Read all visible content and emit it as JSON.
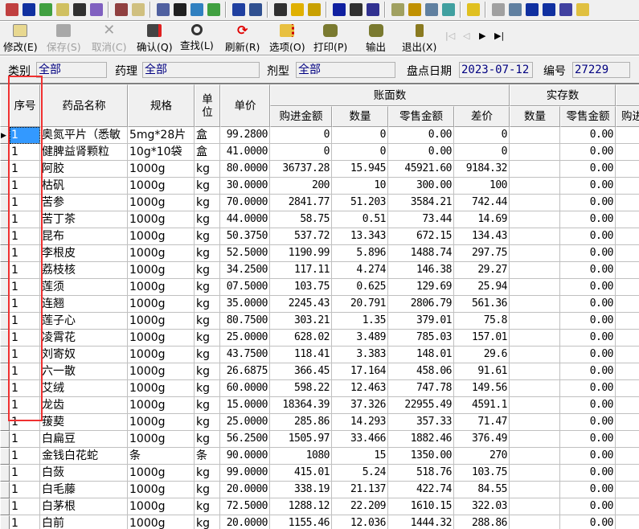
{
  "toolbar_icons": [
    "medical-kit",
    "bottle",
    "mail-check",
    "edit-doc",
    "binoculars",
    "chart-doc",
    "stamp",
    "card",
    "clipboard",
    "checkbox",
    "paste",
    "doc-check",
    "calendar-edit",
    "window-grid",
    "dots-grid",
    "bell",
    "pv-box",
    "bucket",
    "binoculars-2",
    "binoculars-3",
    "hand-folder",
    "key",
    "magnifier",
    "close-box",
    "folder-arrow",
    "disk-gray",
    "magnifier-2",
    "list",
    "windows",
    "doc-check-2",
    "clipboard-2"
  ],
  "toolbar": {
    "edit": "修改(E)",
    "save": "保存(S)",
    "cancel": "取消(C)",
    "confirm": "确认(Q)",
    "find": "查找(L)",
    "refresh": "刷新(R)",
    "options": "选项(O)",
    "print": "打印(P)",
    "export": "输出",
    "exit": "退出(X)"
  },
  "filters": {
    "category_label": "类别",
    "category_value": "全部",
    "pharm_label": "药理",
    "pharm_value": "全部",
    "form_label": "剂型",
    "form_value": "全部",
    "date_label": "盘点日期",
    "date_value": "2023-07-12",
    "no_label": "编号",
    "no_value": "27229"
  },
  "headers": {
    "seq": "序号",
    "name": "药品名称",
    "spec": "规格",
    "unit": "单位",
    "price": "单价",
    "book": "账面数",
    "actual": "实存数",
    "purchase": "购进金额",
    "qty": "数量",
    "retail": "零售金额",
    "diff": "差价",
    "a_qty": "数量",
    "a_retail": "零售金额",
    "a_purchase": "购进"
  },
  "rows": [
    [
      "1",
      "奥氮平片（悉敏",
      "5mg*28片",
      "盒",
      "99.2800",
      "0",
      "0",
      "0.00",
      "0",
      "",
      "0.00"
    ],
    [
      "1",
      "健脾益肾颗粒",
      "10g*10袋",
      "盒",
      "41.0000",
      "0",
      "0",
      "0.00",
      "0",
      "",
      "0.00"
    ],
    [
      "1",
      "阿胶",
      "1000g",
      "kg",
      "80.0000",
      "36737.28",
      "15.945",
      "45921.60",
      "9184.32",
      "",
      "0.00"
    ],
    [
      "1",
      "枯矾",
      "1000g",
      "kg",
      "30.0000",
      "200",
      "10",
      "300.00",
      "100",
      "",
      "0.00"
    ],
    [
      "1",
      "苦参",
      "1000g",
      "kg",
      "70.0000",
      "2841.77",
      "51.203",
      "3584.21",
      "742.44",
      "",
      "0.00"
    ],
    [
      "1",
      "苦丁茶",
      "1000g",
      "kg",
      "44.0000",
      "58.75",
      "0.51",
      "73.44",
      "14.69",
      "",
      "0.00"
    ],
    [
      "1",
      "昆布",
      "1000g",
      "kg",
      "50.3750",
      "537.72",
      "13.343",
      "672.15",
      "134.43",
      "",
      "0.00"
    ],
    [
      "1",
      "李根皮",
      "1000g",
      "kg",
      "52.5000",
      "1190.99",
      "5.896",
      "1488.74",
      "297.75",
      "",
      "0.00"
    ],
    [
      "1",
      "荔枝核",
      "1000g",
      "kg",
      "34.2500",
      "117.11",
      "4.274",
      "146.38",
      "29.27",
      "",
      "0.00"
    ],
    [
      "1",
      "莲须",
      "1000g",
      "kg",
      "07.5000",
      "103.75",
      "0.625",
      "129.69",
      "25.94",
      "",
      "0.00"
    ],
    [
      "1",
      "连翘",
      "1000g",
      "kg",
      "35.0000",
      "2245.43",
      "20.791",
      "2806.79",
      "561.36",
      "",
      "0.00"
    ],
    [
      "1",
      "莲子心",
      "1000g",
      "kg",
      "80.7500",
      "303.21",
      "1.35",
      "379.01",
      "75.8",
      "",
      "0.00"
    ],
    [
      "1",
      "凌霄花",
      "1000g",
      "kg",
      "25.0000",
      "628.02",
      "3.489",
      "785.03",
      "157.01",
      "",
      "0.00"
    ],
    [
      "1",
      "刘寄奴",
      "1000g",
      "kg",
      "43.7500",
      "118.41",
      "3.383",
      "148.01",
      "29.6",
      "",
      "0.00"
    ],
    [
      "1",
      "六一散",
      "1000g",
      "kg",
      "26.6875",
      "366.45",
      "17.164",
      "458.06",
      "91.61",
      "",
      "0.00"
    ],
    [
      "1",
      "艾绒",
      "1000g",
      "kg",
      "60.0000",
      "598.22",
      "12.463",
      "747.78",
      "149.56",
      "",
      "0.00"
    ],
    [
      "1",
      "龙齿",
      "1000g",
      "kg",
      "15.0000",
      "18364.39",
      "37.326",
      "22955.49",
      "4591.1",
      "",
      "0.00"
    ],
    [
      "1",
      "菝葜",
      "1000g",
      "kg",
      "25.0000",
      "285.86",
      "14.293",
      "357.33",
      "71.47",
      "",
      "0.00"
    ],
    [
      "1",
      "白扁豆",
      "1000g",
      "kg",
      "56.2500",
      "1505.97",
      "33.466",
      "1882.46",
      "376.49",
      "",
      "0.00"
    ],
    [
      "1",
      "金钱白花蛇",
      "条",
      "条",
      "90.0000",
      "1080",
      "15",
      "1350.00",
      "270",
      "",
      "0.00"
    ],
    [
      "1",
      "白蔹",
      "1000g",
      "kg",
      "99.0000",
      "415.01",
      "5.24",
      "518.76",
      "103.75",
      "",
      "0.00"
    ],
    [
      "1",
      "白毛藤",
      "1000g",
      "kg",
      "20.0000",
      "338.19",
      "21.137",
      "422.74",
      "84.55",
      "",
      "0.00"
    ],
    [
      "1",
      "白茅根",
      "1000g",
      "kg",
      "72.5000",
      "1288.12",
      "22.209",
      "1610.15",
      "322.03",
      "",
      "0.00"
    ],
    [
      "1",
      "白前",
      "1000g",
      "kg",
      "20.0000",
      "1155.46",
      "12.036",
      "1444.32",
      "288.86",
      "",
      "0.00"
    ]
  ],
  "colors": {
    "highlight": "#f03030",
    "selection": "#3399ff",
    "field_text": "#000080"
  }
}
